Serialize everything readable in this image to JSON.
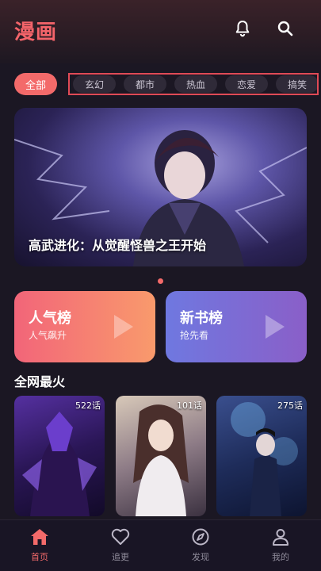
{
  "app": {
    "title": "漫画"
  },
  "categories": {
    "selected": "全部",
    "items": [
      "玄幻",
      "都市",
      "热血",
      "恋爱",
      "搞笑"
    ]
  },
  "banner": {
    "title": "高武进化：从觉醒怪兽之王开始",
    "page_index": 1,
    "page_count": 1
  },
  "rankings": [
    {
      "title": "人气榜",
      "subtitle": "人气飙升"
    },
    {
      "title": "新书榜",
      "subtitle": "抢先看"
    }
  ],
  "section": {
    "title": "全网最火"
  },
  "comics": [
    {
      "episodes": "522话"
    },
    {
      "episodes": "101话"
    },
    {
      "episodes": "275话"
    }
  ],
  "tabs": [
    {
      "label": "首页",
      "icon": "home-icon",
      "active": true
    },
    {
      "label": "追更",
      "icon": "heart-icon",
      "active": false
    },
    {
      "label": "发现",
      "icon": "compass-icon",
      "active": false
    },
    {
      "label": "我的",
      "icon": "user-icon",
      "active": false
    }
  ],
  "colors": {
    "accent": "#f36a6a",
    "background": "#1b1723",
    "highlight_border": "#e04a56"
  }
}
